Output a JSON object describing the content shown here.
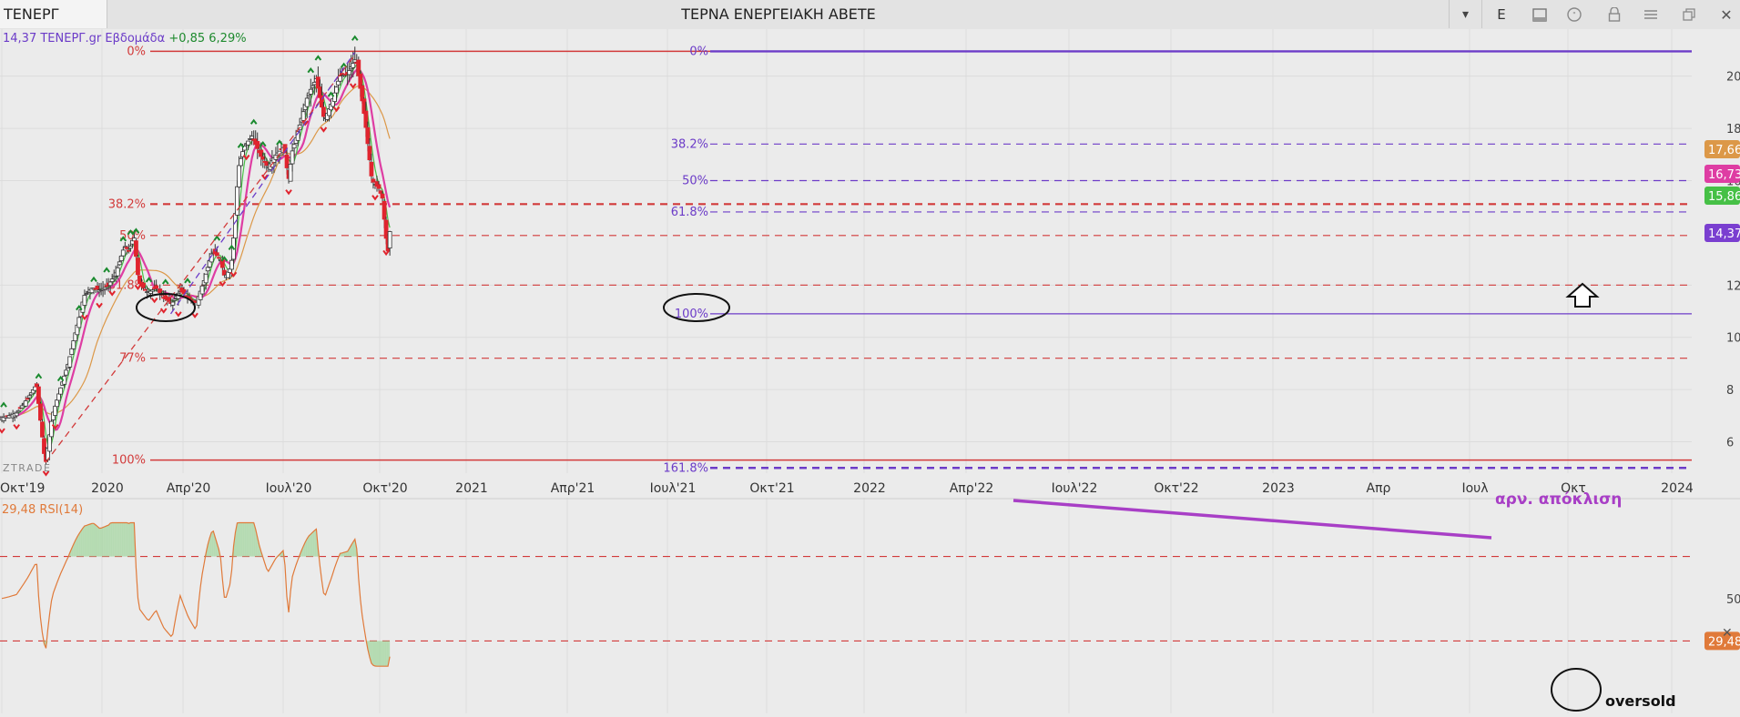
{
  "toolbar": {
    "symbol": "ΤΕΝΕΡΓ",
    "title": "ΤΕΡΝΑ ΕΝΕΡΓΕΙΑΚΗ ΑΒΕΤΕ",
    "e_label": "E",
    "icons": [
      "chevron-down-icon",
      "document-icon",
      "comment-icon",
      "lock-icon",
      "menu-icon",
      "restore-window-icon",
      "close-icon"
    ]
  },
  "info": {
    "last": "14,37",
    "name": "ΤΕΝΕΡΓ.gr Εβδομάδα",
    "change": "+0,85",
    "change_pct": "6,29%"
  },
  "brand": "ZTRADE",
  "colors": {
    "up_candle": "#ffffff",
    "down_candle": "#e0242e",
    "ma_green": "#46c046",
    "ma_pink": "#de3da3",
    "ma_orange": "#dc9848",
    "fib_red": "#d23a3a",
    "fib_purple": "#6c3cc8",
    "rsi_line": "#e07a3a",
    "annotation_purple": "#a83fc6"
  },
  "chart_data": [
    {
      "type": "candlestick",
      "interval": "weekly",
      "x_ticks": [
        "Οκτ'19",
        "2020",
        "Απρ'20",
        "Ιουλ'20",
        "Οκτ'20",
        "2021",
        "Απρ'21",
        "Ιουλ'21",
        "Οκτ'21",
        "2022",
        "Απρ'22",
        "Ιουλ'22",
        "Οκτ'22",
        "2023",
        "Απρ",
        "Ιουλ",
        "Οκτ",
        "2024"
      ],
      "y_ticks": [
        6,
        8,
        10,
        12,
        16,
        18,
        20
      ],
      "ylim": [
        4.8,
        21.8
      ],
      "price_path": [
        [
          "2019-10-01",
          6.9
        ],
        [
          "2019-12-01",
          7.1
        ],
        [
          "2020-01-15",
          7.7
        ],
        [
          "2020-02-15",
          8.2
        ],
        [
          "2020-03-10",
          6.0
        ],
        [
          "2020-03-20",
          5.1
        ],
        [
          "2020-04-15",
          7.0
        ],
        [
          "2020-05-15",
          8.0
        ],
        [
          "2020-06-15",
          9.0
        ],
        [
          "2020-07-15",
          10.3
        ],
        [
          "2020-08-15",
          11.6
        ],
        [
          "2020-09-15",
          11.9
        ],
        [
          "2020-10-15",
          11.8
        ],
        [
          "2020-11-15",
          12.0
        ],
        [
          "2020-12-15",
          12.5
        ],
        [
          "2021-01-15",
          13.5
        ],
        [
          "2021-02-01",
          13.3
        ],
        [
          "2021-02-20",
          13.9
        ],
        [
          "2021-03-10",
          12.1
        ],
        [
          "2021-04-15",
          11.7
        ],
        [
          "2021-05-15",
          11.9
        ],
        [
          "2021-06-15",
          11.5
        ],
        [
          "2021-07-15",
          11.3
        ],
        [
          "2021-08-15",
          11.8
        ],
        [
          "2021-09-15",
          11.5
        ],
        [
          "2021-10-15",
          11.3
        ],
        [
          "2021-11-15",
          12.2
        ],
        [
          "2021-12-15",
          13.3
        ],
        [
          "2022-01-15",
          13.0
        ],
        [
          "2022-02-01",
          12.3
        ],
        [
          "2022-02-25",
          12.7
        ],
        [
          "2022-03-10",
          14.3
        ],
        [
          "2022-03-25",
          16.5
        ],
        [
          "2022-04-15",
          17.3
        ],
        [
          "2022-05-15",
          17.7
        ],
        [
          "2022-06-15",
          17.0
        ],
        [
          "2022-07-15",
          16.5
        ],
        [
          "2022-08-15",
          17.0
        ],
        [
          "2022-09-15",
          17.3
        ],
        [
          "2022-10-01",
          16.0
        ],
        [
          "2022-10-15",
          17.1
        ],
        [
          "2022-11-15",
          18.2
        ],
        [
          "2022-12-15",
          19.3
        ],
        [
          "2023-01-15",
          19.9
        ],
        [
          "2023-02-15",
          18.3
        ],
        [
          "2023-03-15",
          19.0
        ],
        [
          "2023-04-15",
          20.0
        ],
        [
          "2023-05-15",
          20.1
        ],
        [
          "2023-06-15",
          20.7
        ],
        [
          "2023-07-01",
          19.6
        ],
        [
          "2023-07-20",
          18.3
        ],
        [
          "2023-08-15",
          16.0
        ],
        [
          "2023-09-10",
          15.7
        ],
        [
          "2023-09-25",
          15.3
        ],
        [
          "2023-10-05",
          14.0
        ],
        [
          "2023-10-15",
          13.3
        ],
        [
          "2023-10-25",
          14.37
        ]
      ],
      "swing_highs": [
        "2019-10-15",
        "2020-02-20",
        "2020-05-20",
        "2020-07-25",
        "2020-09-20",
        "2020-11-10",
        "2021-01-10",
        "2021-02-10",
        "2021-02-25",
        "2021-04-15",
        "2021-06-20",
        "2021-09-10",
        "2022-01-05",
        "2022-01-30",
        "2022-02-25",
        "2022-04-05",
        "2022-05-20",
        "2022-06-25",
        "2022-08-25",
        "2022-12-25",
        "2023-01-25",
        "2023-03-10",
        "2023-04-30",
        "2023-06-10"
      ],
      "swing_lows": [
        "2019-10-05",
        "2019-11-30",
        "2020-03-20",
        "2020-04-25",
        "2020-08-15",
        "2020-10-10",
        "2020-11-30",
        "2021-03-10",
        "2021-05-10",
        "2021-06-15",
        "2021-08-05",
        "2021-10-10",
        "2022-01-20",
        "2022-03-05",
        "2022-04-25",
        "2022-07-05",
        "2022-10-05",
        "2022-12-05",
        "2023-02-10",
        "2023-04-01",
        "2023-06-01",
        "2023-08-25",
        "2023-10-05"
      ],
      "fibonacci_left": {
        "levels": [
          "0%",
          "38.2%",
          "50%",
          "61.8%",
          "77%",
          "100%"
        ],
        "prices": [
          20.95,
          15.1,
          13.9,
          12.0,
          9.2,
          5.3
        ]
      },
      "fibonacci_right": {
        "levels": [
          "0%",
          "38.2%",
          "50%",
          "61.8%",
          "100%",
          "161.8%"
        ],
        "prices": [
          20.95,
          17.4,
          16.0,
          14.8,
          10.9,
          5.0
        ]
      },
      "price_labels": [
        "17,66",
        "16,73",
        "15,86",
        "14,37"
      ],
      "annotations": [
        "oversold",
        "αρν. απόκλιση"
      ]
    },
    {
      "type": "line",
      "name": "RSI(14)",
      "last_value": "29,48",
      "y_ticks": [
        "50"
      ],
      "levels": [
        70,
        30
      ],
      "highlighted_text": "29,48"
    }
  ]
}
